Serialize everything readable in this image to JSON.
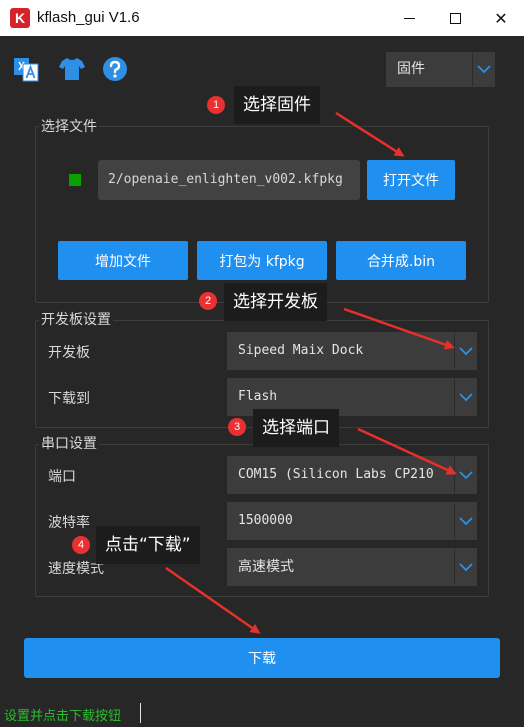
{
  "window": {
    "title": "kflash_gui V1.6",
    "logo_letter": "K",
    "minimize_icon": "minimize-icon",
    "maximize_icon": "maximize-icon",
    "close_glyph": "✕"
  },
  "toolbar": {
    "icons": [
      "language-icon",
      "shirt-icon",
      "help-icon"
    ],
    "firmware_combo": {
      "value": "固件"
    }
  },
  "file_group": {
    "title": "选择文件",
    "path": "2/openaie_enlighten_v002.kfpkg",
    "open_file_label": "打开文件",
    "add_file_label": "增加文件",
    "pack_label": "打包为 kfpkg",
    "merge_label": "合并成.bin",
    "status_color": "#0aa000"
  },
  "board_group": {
    "title": "开发板设置",
    "board_label": "开发板",
    "board_value": "Sipeed Maix Dock",
    "download_to_label": "下载到",
    "download_to_value": "Flash"
  },
  "serial_group": {
    "title": "串口设置",
    "port_label": "端口",
    "port_value": "COM15 (Silicon Labs CP210",
    "baud_label": "波特率",
    "baud_value": "1500000",
    "speed_label": "速度模式",
    "speed_value": "高速模式"
  },
  "download_button": {
    "label": "下载"
  },
  "status": {
    "text": "设置并点击下载按钮"
  },
  "annotations": [
    {
      "num": "1",
      "text": "选择固件"
    },
    {
      "num": "2",
      "text": "选择开发板"
    },
    {
      "num": "3",
      "text": "选择端口"
    },
    {
      "num": "4",
      "text": "点击“下载”"
    }
  ],
  "colors": {
    "accent": "#1f8ff0",
    "background": "#272727",
    "annotation_arrow": "#e8302a",
    "status_text": "#2dbb2d"
  }
}
